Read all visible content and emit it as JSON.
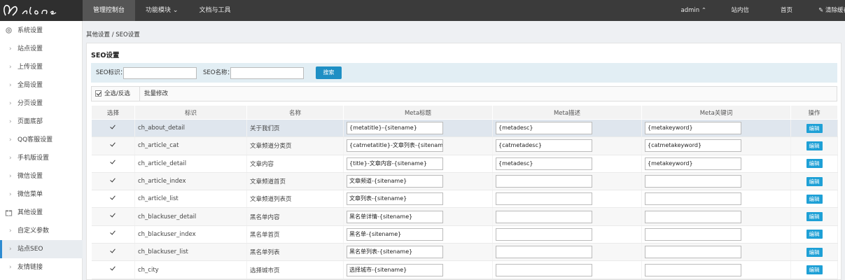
{
  "header": {
    "nav": [
      "管理控制台",
      "功能模块",
      "文档与工具"
    ],
    "active_nav": 0,
    "right": {
      "user": "admin",
      "messages": "站内信",
      "home": "首页",
      "clear_cache": "清除缓存"
    }
  },
  "sidebar": {
    "items": [
      {
        "label": "系统设置",
        "type": "group",
        "icon": "gear-icon"
      },
      {
        "label": "站点设置",
        "type": "child"
      },
      {
        "label": "上传设置",
        "type": "child"
      },
      {
        "label": "全局设置",
        "type": "child"
      },
      {
        "label": "分页设置",
        "type": "child"
      },
      {
        "label": "页面底部",
        "type": "child"
      },
      {
        "label": "QQ客服设置",
        "type": "child"
      },
      {
        "label": "手机版设置",
        "type": "child"
      },
      {
        "label": "微信设置",
        "type": "child"
      },
      {
        "label": "微信菜单",
        "type": "child"
      },
      {
        "label": "其他设置",
        "type": "group",
        "icon": "gift-icon"
      },
      {
        "label": "自定义参数",
        "type": "child"
      },
      {
        "label": "站点SEO",
        "type": "child",
        "active": true
      },
      {
        "label": "友情链接",
        "type": "child"
      }
    ]
  },
  "breadcrumb": "其他设置 / SEO设置",
  "panel": {
    "title": "SEO设置",
    "search": {
      "id_label": "SEO标识：",
      "name_label": "SEO名称：",
      "id_value": "",
      "name_value": "",
      "button": "搜索"
    },
    "toolbar": {
      "select_all": "全选/反选",
      "batch_edit": "批量修改"
    }
  },
  "table": {
    "columns": [
      "选择",
      "标识",
      "名称",
      "Meta标题",
      "Meta描述",
      "Meta关键词",
      "操作"
    ],
    "edit_label": "编辑",
    "rows": [
      {
        "id": "ch_about_detail",
        "name": "关于我们页",
        "title": "{metatitle}-{sitename}",
        "desc": "{metadesc}",
        "keywords": "{metakeyword}"
      },
      {
        "id": "ch_article_cat",
        "name": "文章频道分类页",
        "title": "{catmetatitle}-文章列表-{sitename}",
        "desc": "{catmetadesc}",
        "keywords": "{catmetakeyword}"
      },
      {
        "id": "ch_article_detail",
        "name": "文章内容",
        "title": "{title}-文章内容-{sitename}",
        "desc": "{metadesc}",
        "keywords": "{metakeyword}"
      },
      {
        "id": "ch_article_index",
        "name": "文章频道首页",
        "title": "文章频道-{sitename}",
        "desc": "",
        "keywords": ""
      },
      {
        "id": "ch_article_list",
        "name": "文章频道列表页",
        "title": "文章列表-{sitename}",
        "desc": "",
        "keywords": ""
      },
      {
        "id": "ch_blackuser_detail",
        "name": "黑名单内容",
        "title": "黑名单详情-{sitename}",
        "desc": "",
        "keywords": ""
      },
      {
        "id": "ch_blackuser_index",
        "name": "黑名单首页",
        "title": "黑名单-{sitename}",
        "desc": "",
        "keywords": ""
      },
      {
        "id": "ch_blackuser_list",
        "name": "黑名单列表",
        "title": "黑名单列表-{sitename}",
        "desc": "",
        "keywords": ""
      },
      {
        "id": "ch_city",
        "name": "选择城市页",
        "title": "选择城市-{sitename}",
        "desc": "",
        "keywords": ""
      }
    ]
  }
}
